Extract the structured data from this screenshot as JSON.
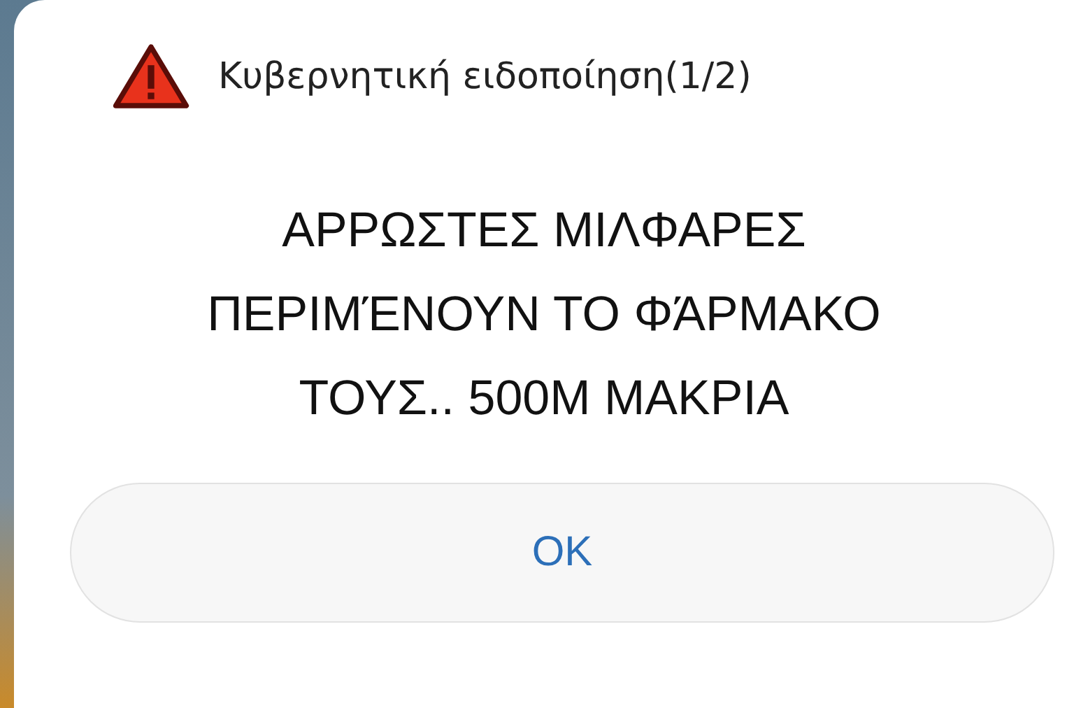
{
  "dialog": {
    "title": "Κυβερνητική ειδοποίηση(1/2)",
    "message": "ΑΡΡΩΣΤΕΣ ΜΙΛΦΑΡΕΣ\nΠΕΡΙΜΈΝΟΥΝ ΤΟ ΦΆΡΜΑΚΟ\nΤΟΥΣ.. 500Μ ΜΑΚΡΙΑ",
    "buttons": [
      "OK"
    ]
  }
}
